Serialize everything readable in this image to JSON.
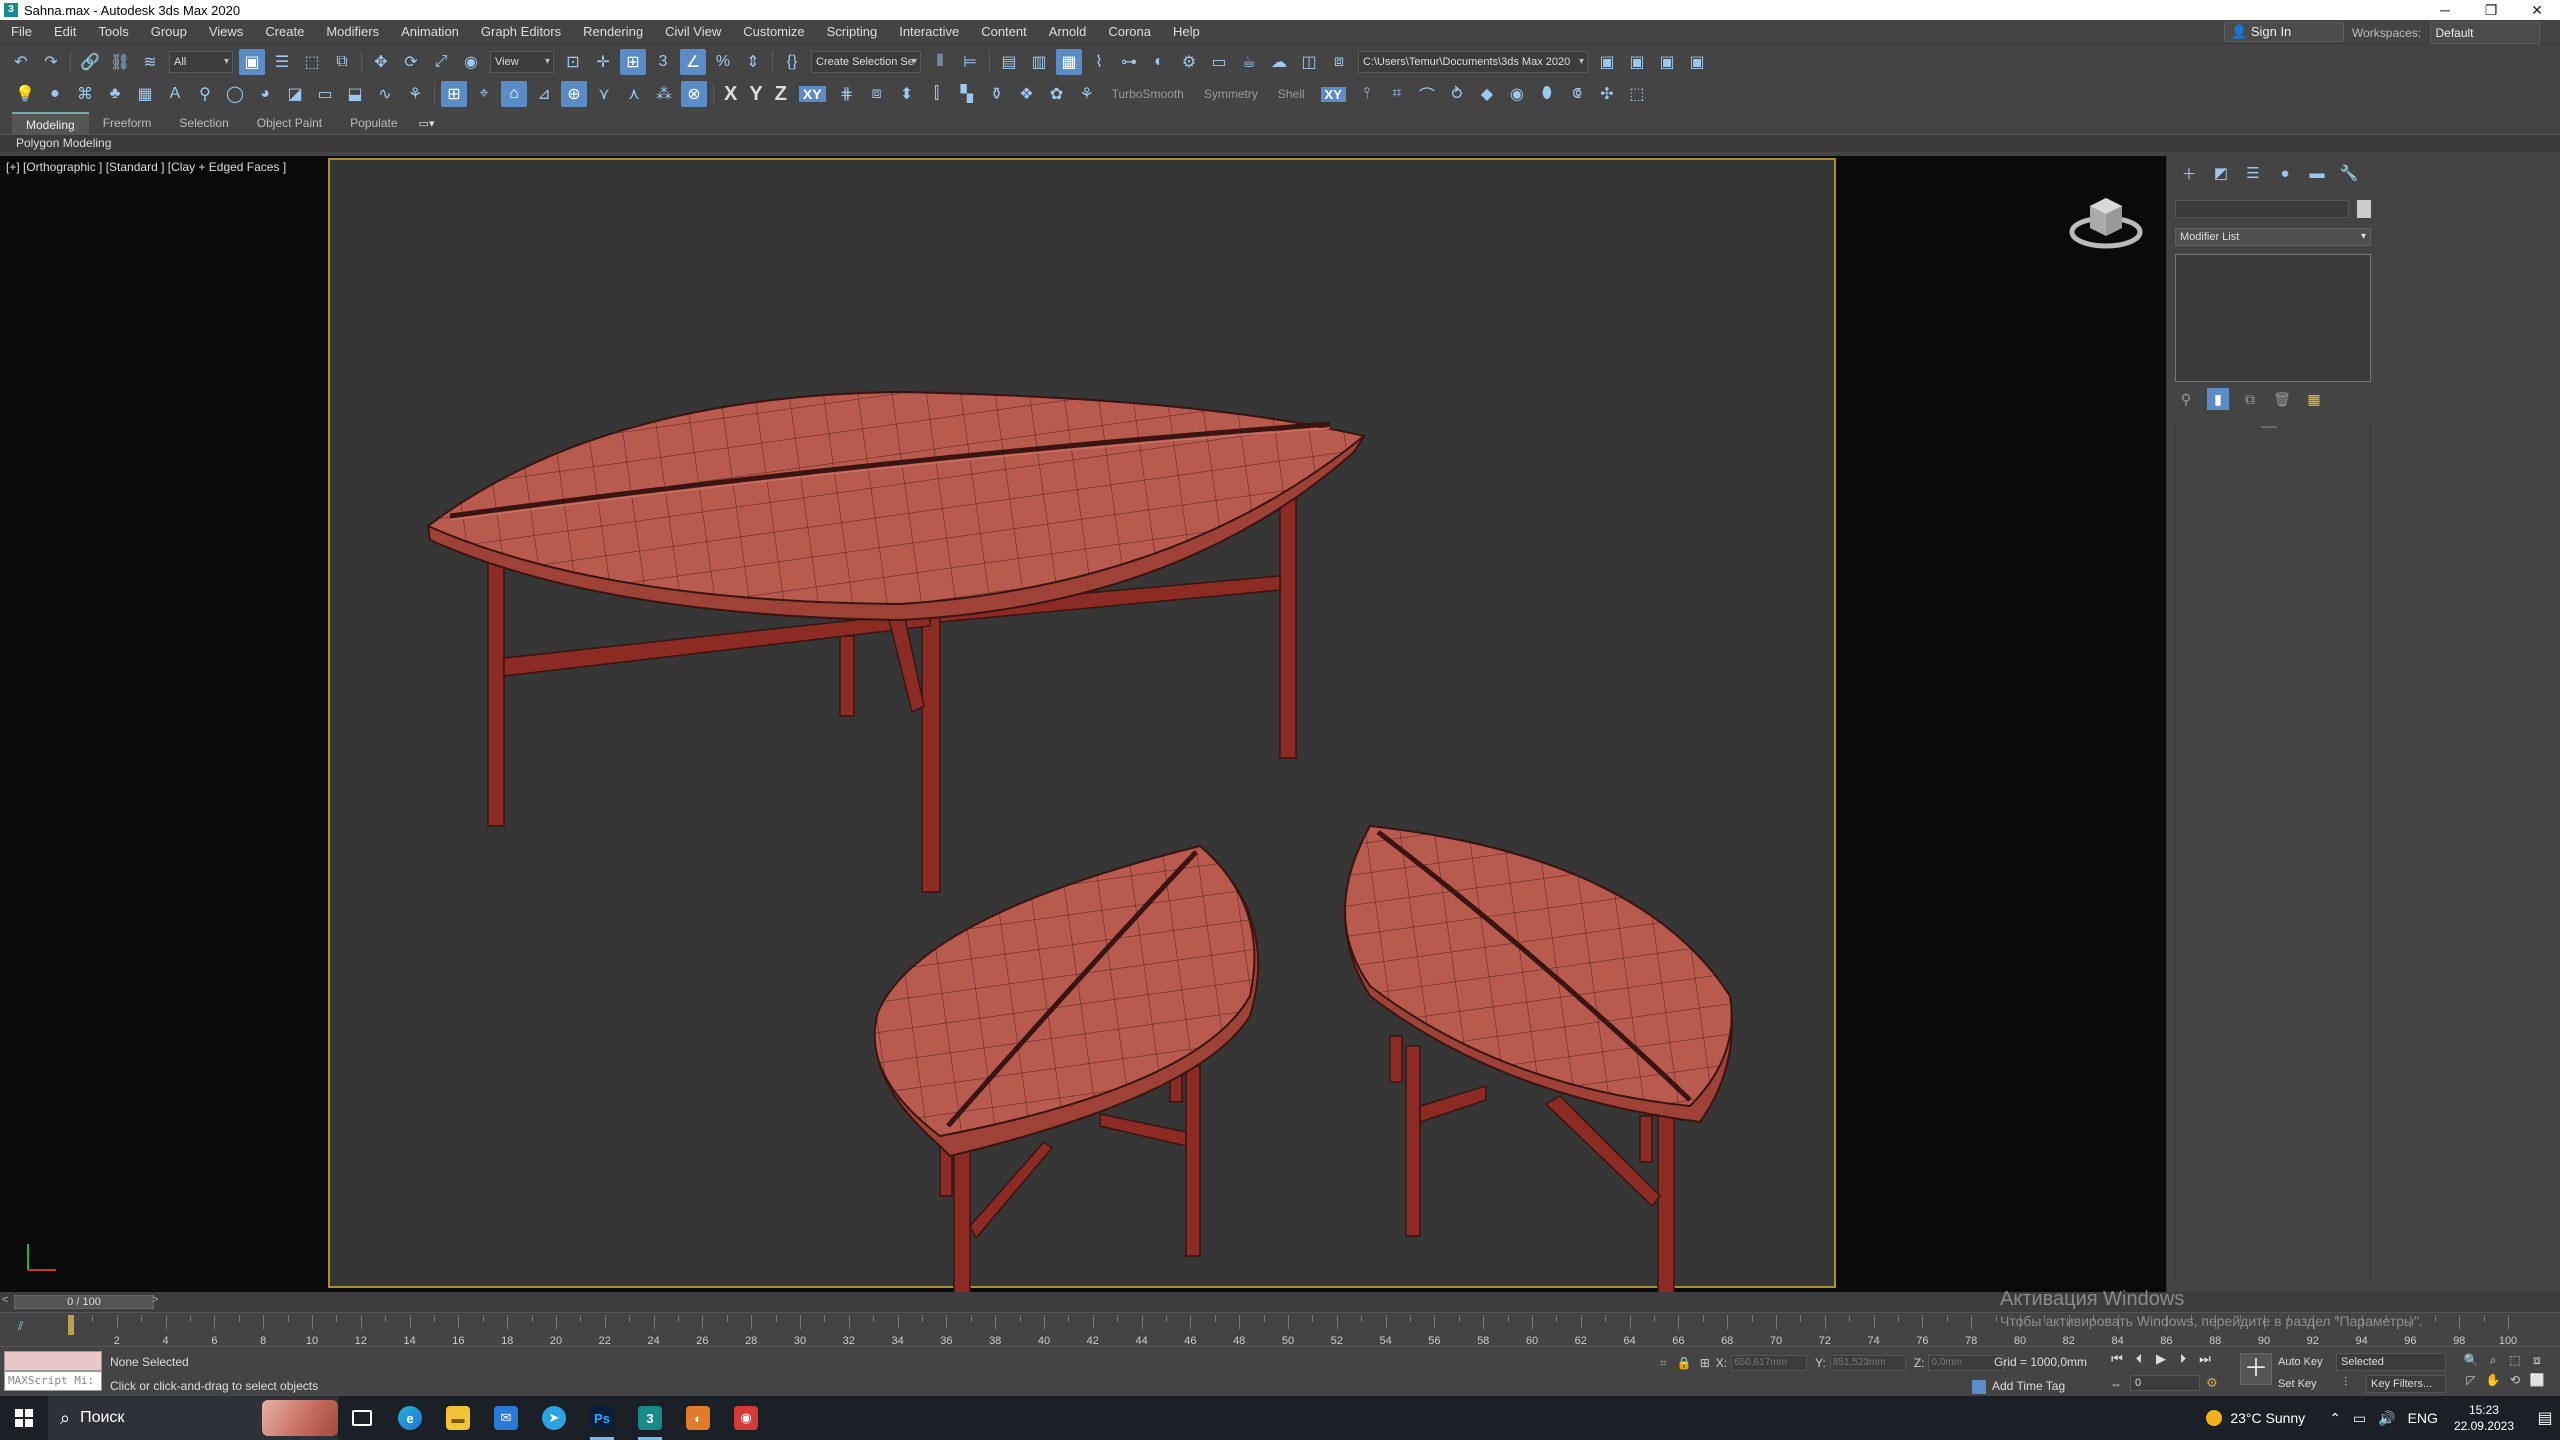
{
  "window": {
    "title": "Sahna.max - Autodesk 3ds Max 2020",
    "app_icon_letter": "3",
    "controls": [
      "─",
      "❐",
      "✕"
    ]
  },
  "menu": {
    "items": [
      "File",
      "Edit",
      "Tools",
      "Group",
      "Views",
      "Create",
      "Modifiers",
      "Animation",
      "Graph Editors",
      "Rendering",
      "Civil View",
      "Customize",
      "Scripting",
      "Interactive",
      "Content",
      "Arnold",
      "Corona",
      "Help"
    ],
    "sign_in": "Sign In",
    "workspaces_label": "Workspaces:",
    "workspaces_value": "Default"
  },
  "toolbar1": {
    "filter_value": "All",
    "ref_coord_value": "View",
    "named_selection_value": "Create Selection Se",
    "project_path": "C:\\Users\\Temur\\Documents\\3ds Max 2020"
  },
  "toolbar2": {
    "axis_x": "X",
    "axis_y": "Y",
    "axis_z": "Z",
    "axis_xy": "XY",
    "turbosmooth": "TurboSmooth",
    "symmetry": "Symmetry",
    "shell": "Shell",
    "xy_active": "XY"
  },
  "ribbon": {
    "tabs": [
      "Modeling",
      "Freeform",
      "Selection",
      "Object Paint",
      "Populate"
    ],
    "active_tab": "Modeling",
    "sub_label": "Polygon Modeling"
  },
  "viewport": {
    "label": "[+] [Orthographic ] [Standard ] [Clay + Edged Faces ]",
    "clay_color": "#b85a4e",
    "edge_color": "#3a1410"
  },
  "command_panel": {
    "modifier_list": "Modifier List"
  },
  "timeline": {
    "frame_counter": "0 / 100",
    "ticks": [
      0,
      2,
      4,
      6,
      8,
      10,
      12,
      14,
      16,
      18,
      20,
      22,
      24,
      26,
      28,
      30,
      32,
      34,
      36,
      38,
      40,
      42,
      44,
      46,
      48,
      50,
      52,
      54,
      56,
      58,
      60,
      62,
      64,
      66,
      68,
      70,
      72,
      74,
      76,
      78,
      80,
      82,
      84,
      86,
      88,
      90,
      92,
      94,
      96,
      98,
      100
    ]
  },
  "status": {
    "maxscript_label": "MAXScript Mi:",
    "selection": "None Selected",
    "prompt": "Click or click-and-drag to select objects",
    "x_label": "X:",
    "x_value": "650,617mm",
    "y_label": "Y:",
    "y_value": "851,523mm",
    "z_label": "Z:",
    "z_value": "0,0mm",
    "grid": "Grid = 1000,0mm",
    "add_time_tag": "Add Time Tag",
    "frame_value": "0",
    "auto_key": "Auto Key",
    "set_key": "Set Key",
    "key_selected": "Selected",
    "key_filters": "Key Filters..."
  },
  "watermark": {
    "line1": "Активация Windows",
    "line2": "Чтобы активировать Windows, перейдите в раздел \"Параметры\"."
  },
  "taskbar": {
    "search_placeholder": "Поиск",
    "weather": "23°C  Sunny",
    "lang": "ENG",
    "time": "15:23",
    "date": "22.09.2023"
  }
}
